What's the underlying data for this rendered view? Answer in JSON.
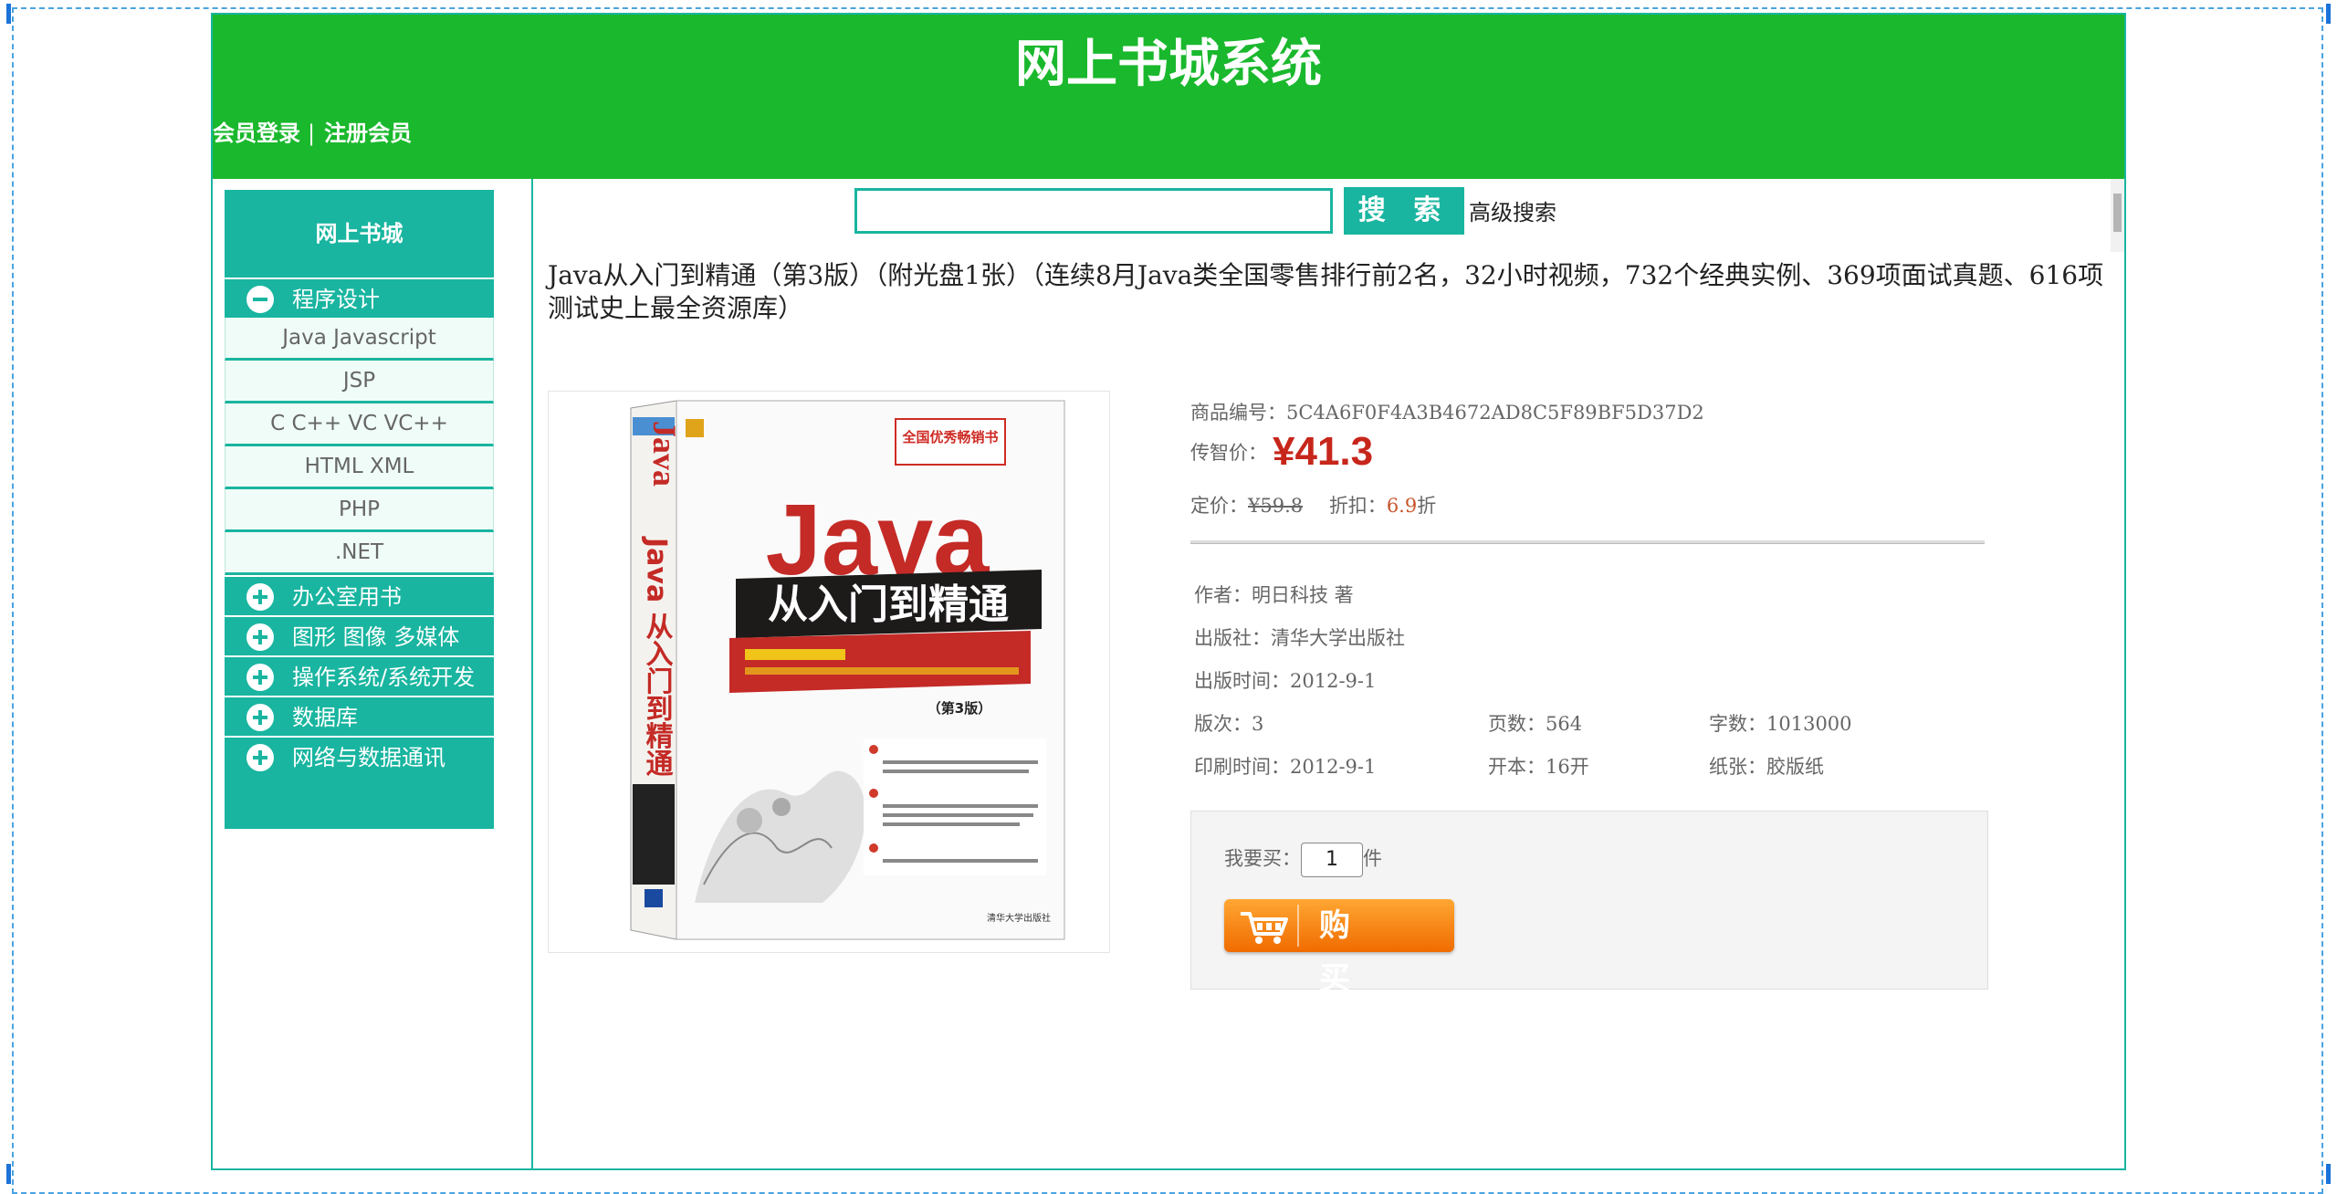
{
  "header": {
    "site_title": "网上书城系统",
    "login_link": "会员登录",
    "separator": "|",
    "register_link": "注册会员"
  },
  "sidebar": {
    "heading": "网上书城",
    "categories": [
      {
        "label": "程序设计",
        "expanded": true,
        "items": [
          "Java Javascript",
          "JSP",
          "C C++ VC VC++",
          "HTML XML",
          "PHP",
          ".NET"
        ]
      },
      {
        "label": "办公室用书",
        "expanded": false
      },
      {
        "label": "图形 图像 多媒体",
        "expanded": false
      },
      {
        "label": "操作系统/系统开发",
        "expanded": false
      },
      {
        "label": "数据库",
        "expanded": false
      },
      {
        "label": "网络与数据通讯",
        "expanded": false
      }
    ]
  },
  "search": {
    "value": "",
    "button_label": "搜 索",
    "advanced_label": "高级搜索"
  },
  "product": {
    "title": "Java从入门到精通（第3版）（附光盘1张）（连续8月Java类全国零售排行前2名，32小时视频，732个经典实例、369项面试真题、616项测试史上最全资源库）",
    "cover": {
      "spine_title": "Java 从入门到精通",
      "badge": "全国优秀畅销书",
      "main_word": "Java",
      "subtitle": "从入门到精通",
      "edition": "（第3版）",
      "publisher": "清华大学出版社"
    },
    "id_label": "商品编号：",
    "id": "5C4A6F0F4A3B4672AD8C5F89BF5D37D2",
    "price_label": "传智价：",
    "price": "¥41.3",
    "list_price_label": "定价：",
    "list_price": "¥59.8",
    "discount_label": "折扣：",
    "discount": "6.9",
    "discount_unit": "折",
    "author": "作者：明日科技 著",
    "publisher": "出版社：清华大学出版社",
    "publish_date": "出版时间：2012-9-1",
    "edition": "版次：3",
    "pages": "页数：564",
    "words": "字数：1013000",
    "print_date": "印刷时间：2012-9-1",
    "format": "开本：16开",
    "paper": "纸张：胶版纸",
    "buy_prefix": "我要买：",
    "quantity": "1",
    "buy_suffix": "件",
    "buy_button": "购 买"
  },
  "colors": {
    "header_green": "#1ab82d",
    "teal": "#19b5a0",
    "price_red": "#c7261b",
    "buy_orange": "#f08a12"
  }
}
